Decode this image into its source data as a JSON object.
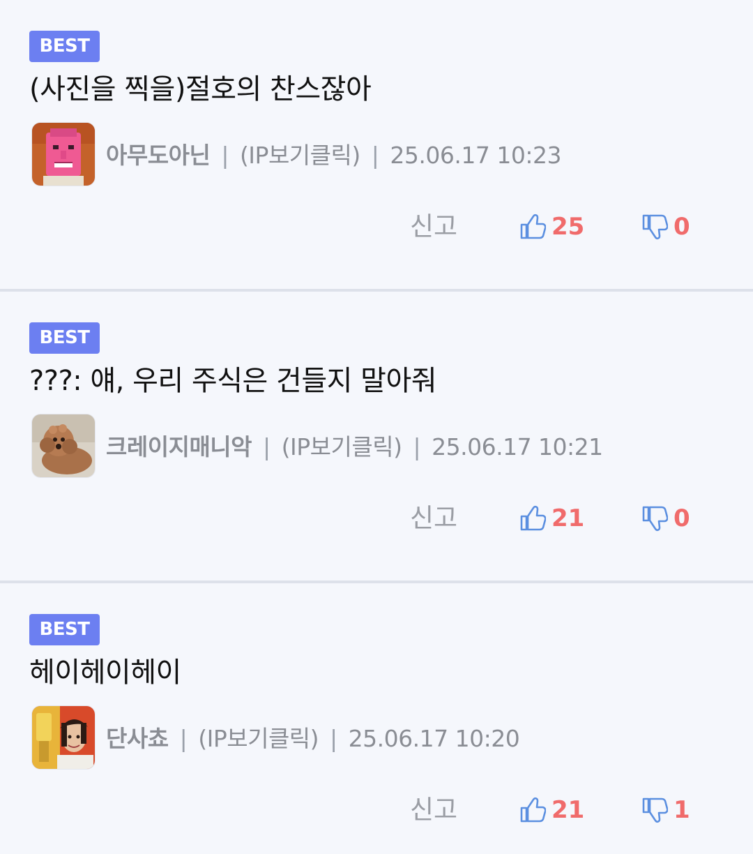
{
  "comments": [
    {
      "badge": "BEST",
      "text": "(사진을 찍을)절호의 찬스잖아",
      "author": "아무도아닌",
      "ip_label": "(IP보기클릭)",
      "timestamp": "25.06.17 10:23",
      "separator": "|",
      "report_label": "신고",
      "likes": "25",
      "dislikes": "0",
      "avatar": "pink-face-avatar"
    },
    {
      "badge": "BEST",
      "text": "???: 얘, 우리 주식은 건들지 말아줘",
      "author": "크레이지매니악",
      "ip_label": "(IP보기클릭)",
      "timestamp": "25.06.17 10:21",
      "separator": "|",
      "report_label": "신고",
      "likes": "21",
      "dislikes": "0",
      "avatar": "poodle-avatar"
    },
    {
      "badge": "BEST",
      "text": "헤이헤이헤이",
      "author": "단사쵸",
      "ip_label": "(IP보기클릭)",
      "timestamp": "25.06.17 10:20",
      "separator": "|",
      "report_label": "신고",
      "likes": "21",
      "dislikes": "1",
      "avatar": "person-photo-avatar"
    }
  ],
  "colors": {
    "background": "#f5f7fc",
    "badge": "#6c7ff1",
    "count": "#f06b6b",
    "thumb_icon": "#5b8fe0",
    "meta_text": "#8a8d94",
    "divider": "#dde1ea"
  }
}
